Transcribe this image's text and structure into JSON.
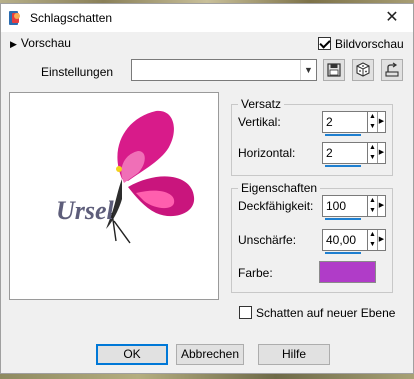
{
  "window": {
    "title": "Schlagschatten"
  },
  "top": {
    "preview_toggle_label": "Vorschau",
    "image_preview_label": "Bildvorschau",
    "image_preview_checked": true
  },
  "settings": {
    "label": "Einstellungen",
    "value": ""
  },
  "preview": {
    "signature_text": "Ursel"
  },
  "offset": {
    "title": "Versatz",
    "vertical_label": "Vertikal:",
    "vertical_value": "2",
    "horizontal_label": "Horizontal:",
    "horizontal_value": "2"
  },
  "properties": {
    "title": "Eigenschaften",
    "opacity_label": "Deckfähigkeit:",
    "opacity_value": "100",
    "blur_label": "Unschärfe:",
    "blur_value": "40,00",
    "color_label": "Farbe:",
    "color_hex": "#b03cc8"
  },
  "shadow_layer": {
    "label": "Schatten auf neuer Ebene",
    "checked": false
  },
  "buttons": {
    "ok": "OK",
    "cancel": "Abbrechen",
    "help": "Hilfe"
  }
}
